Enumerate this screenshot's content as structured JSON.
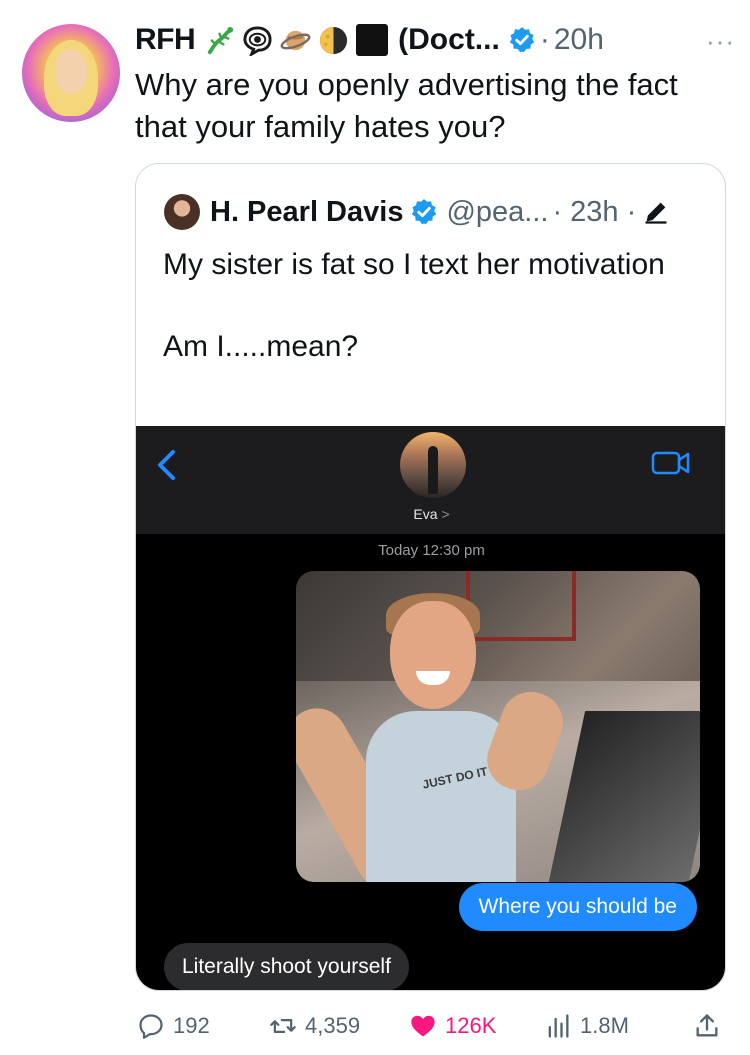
{
  "tweet": {
    "display_name": "RFH",
    "name_suffix": "(Doct...",
    "dot": "·",
    "time": "20h",
    "more": "···",
    "text": "Why are you openly advertising the fact that your family hates you?",
    "emoji_icons": [
      "lizard-emoji-icon",
      "eye-in-speech-bubble-icon",
      "ringed-planet-icon",
      "last-quarter-moon-icon",
      "black-square-icon"
    ]
  },
  "quote": {
    "display_name": "H. Pearl Davis",
    "handle": "@pea...",
    "time": "· 23h ·",
    "text_line1": "My sister is fat so I text her motivation",
    "text_line2": "Am I.....mean?"
  },
  "sms": {
    "contact_name": "Eva",
    "contact_chevron": ">",
    "timestamp": "Today 12:30 pm",
    "photo_shirt_text": "JUST DO IT",
    "outgoing": "Where you should be",
    "incoming": "Literally shoot yourself"
  },
  "actions": {
    "replies": "192",
    "reposts": "4,359",
    "likes": "126K",
    "views": "1.8M"
  },
  "colors": {
    "verified": "#1d9bf0",
    "like": "#f91880",
    "imessage_blue": "#1f8bff",
    "muted": "#536471"
  }
}
